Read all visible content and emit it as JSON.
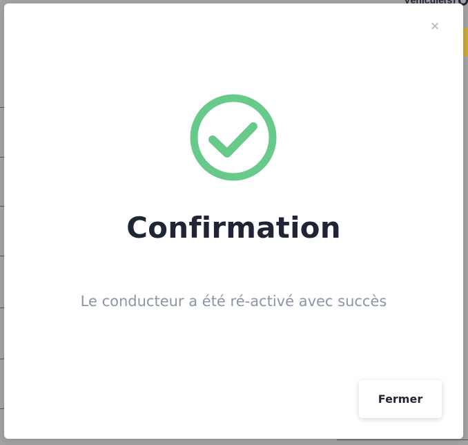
{
  "background": {
    "corner_text": "Véhicule(s)"
  },
  "modal": {
    "close_icon_glyph": "×",
    "icon": "check-circle-icon",
    "title": "Confirmation",
    "message": "Le conducteur a été ré-activé avec succès",
    "close_button_label": "Fermer",
    "colors": {
      "success": "#67c98a",
      "title": "#1f2535",
      "message": "#8b95a6",
      "close_icon": "#b9bec6"
    }
  }
}
